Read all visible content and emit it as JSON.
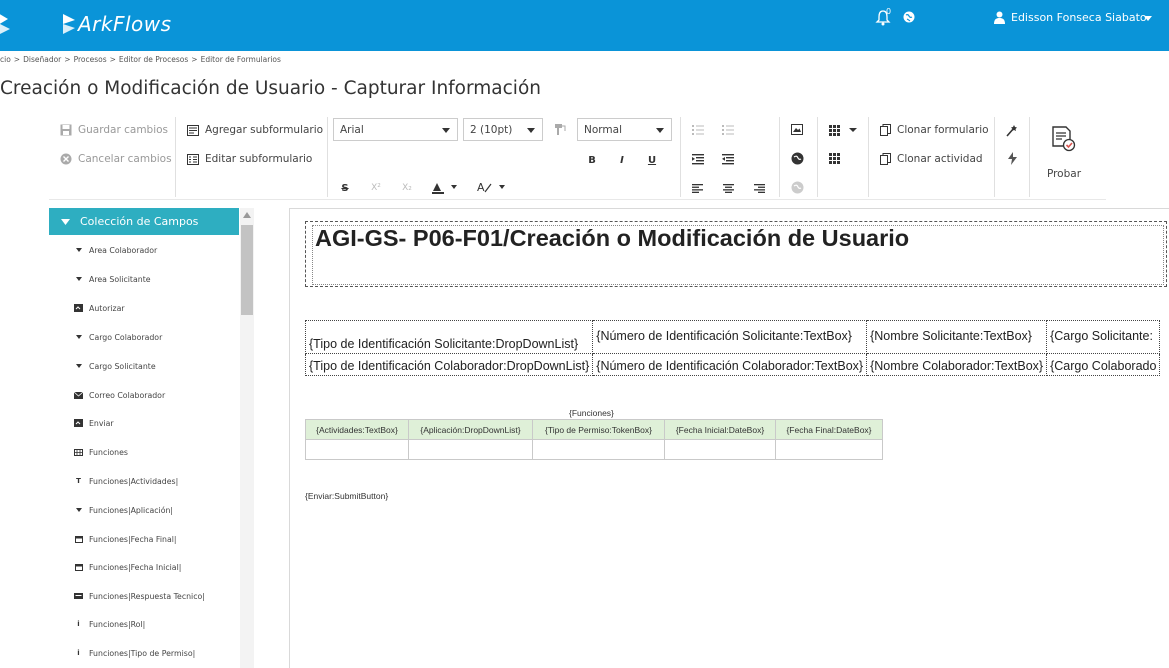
{
  "header": {
    "logo_text": "ArkFlows",
    "notification_count": "0",
    "user_name": "Edisson Fonseca Siabato"
  },
  "breadcrumb": [
    "cio",
    ">",
    "Diseñador",
    ">",
    "Procesos",
    ">",
    "Editor de Procesos",
    ">",
    "Editor de Formularios"
  ],
  "page_title": "Creación o Modificación de Usuario - Capturar Información",
  "toolbar": {
    "save": "Guardar cambios",
    "cancel": "Cancelar cambios",
    "add_subform": "Agregar subformulario",
    "edit_subform": "Editar subformulario",
    "font_family": "Arial",
    "font_size": "2 (10pt)",
    "paragraph_style": "Normal",
    "bold": "B",
    "italic": "I",
    "underline": "U",
    "strike": "S",
    "superscript": "X²",
    "subscript": "X₂",
    "clone_form": "Clonar formulario",
    "clone_activity": "Clonar actividad",
    "test": "Probar"
  },
  "sidebar": {
    "header": "Colección de Campos",
    "items": [
      {
        "label": "Area Colaborador",
        "icon": "caret-down-icon"
      },
      {
        "label": "Area Solicitante",
        "icon": "caret-down-icon"
      },
      {
        "label": "Autorizar",
        "icon": "submit-icon"
      },
      {
        "label": "Cargo Colaborador",
        "icon": "caret-down-icon"
      },
      {
        "label": "Cargo Solicitante",
        "icon": "caret-down-icon"
      },
      {
        "label": "Correo Colaborador",
        "icon": "envelope-icon"
      },
      {
        "label": "Enviar",
        "icon": "submit-icon"
      },
      {
        "label": "Funciones",
        "icon": "table-icon"
      },
      {
        "label": "Funciones|Actividades|",
        "icon": "text-icon"
      },
      {
        "label": "Funciones|Aplicación|",
        "icon": "caret-down-icon"
      },
      {
        "label": "Funciones|Fecha Final|",
        "icon": "calendar-icon"
      },
      {
        "label": "Funciones|Fecha Inicial|",
        "icon": "calendar-icon"
      },
      {
        "label": "Funciones|Respuesta Tecnico|",
        "icon": "textarea-icon"
      },
      {
        "label": "Funciones|Rol|",
        "icon": "info-icon"
      },
      {
        "label": "Funciones|Tipo de Permiso|",
        "icon": "info-icon"
      }
    ]
  },
  "form": {
    "title": "AGI-GS- P06-F01/Creación o Modificación de Usuario",
    "id_rows": [
      [
        "{Tipo de Identificación Solicitante:DropDownList}",
        "{Número de Identificación Solicitante:TextBox}",
        "{Nombre Solicitante:TextBox}",
        "{Cargo Solicitante:"
      ],
      [
        "{Tipo de Identificación Colaborador:DropDownList}",
        "{Número de Identificación Colaborador:TextBox}",
        "{Nombre Colaborador:TextBox}",
        "{Cargo Colaborado"
      ]
    ],
    "functions_caption": "{Funciones}",
    "functions_headers": [
      "{Actividades:TextBox}",
      "{Aplicación:DropDownList}",
      "{Tipo de Permiso:TokenBox}",
      "{Fecha Inicial:DateBox}",
      "{Fecha Final:DateBox}"
    ],
    "submit_field": "{Enviar:SubmitButton}"
  },
  "colors": {
    "topbar": "#0a94d8",
    "sidebar_header": "#2eaec1",
    "table_header": "#dff0d8"
  }
}
